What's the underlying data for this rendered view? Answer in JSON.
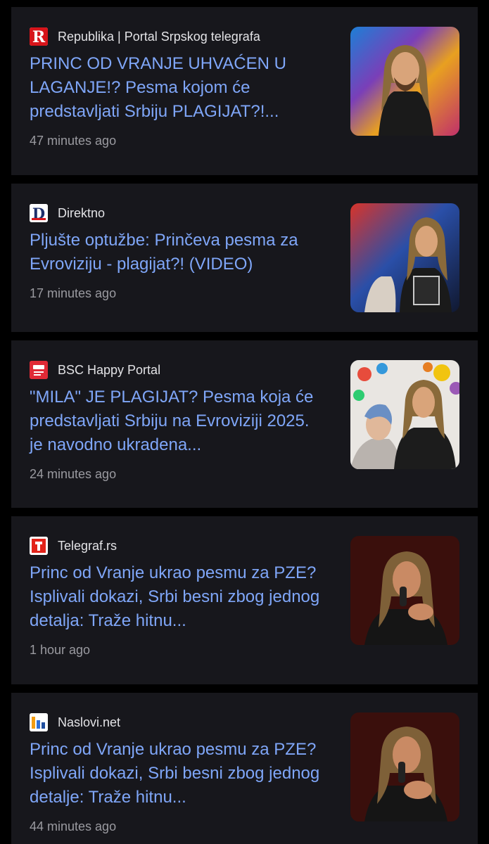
{
  "articles": [
    {
      "source": "Republika | Portal Srpskog telegrafa",
      "logo_icon": "republika-r-logo-icon",
      "headline": "PRINC OD VRANJE UHVAĆEN U LAGANJE!? Pesma kojom će predstavljati Srbiju PLAGIJAT?!...",
      "time": "47 minutes ago"
    },
    {
      "source": "Direktno",
      "logo_icon": "direktno-d-logo-icon",
      "headline": "Pljušte optužbe: Prinčeva pesma za Evroviziju - plagijat?! (VIDEO)",
      "time": "17 minutes ago"
    },
    {
      "source": "BSC Happy Portal",
      "logo_icon": "bsc-happy-logo-icon",
      "headline": "\"MILA\" JE PLAGIJAT? Pesma koja će predstavljati Srbiju na Evroviziji 2025. je navodno ukradena...",
      "time": "24 minutes ago"
    },
    {
      "source": "Telegraf.rs",
      "logo_icon": "telegraf-logo-icon",
      "headline": "Princ od Vranje ukrao pesmu za PZE? Isplivali dokazi, Srbi besni zbog jednog detalja: Traže hitnu...",
      "time": "1 hour ago"
    },
    {
      "source": "Naslovi.net",
      "logo_icon": "naslovi-logo-icon",
      "headline": "Princ od Vranje ukrao pesmu za PZE? Isplivali dokazi, Srbi besni zbog jednog detalje: Traže hitnu...",
      "time": "44 minutes ago"
    }
  ],
  "colors": {
    "background": "#000000",
    "card": "#17171c",
    "headline": "#7fa6f8",
    "source": "#e3e3e6",
    "time": "#9a9aa0"
  }
}
